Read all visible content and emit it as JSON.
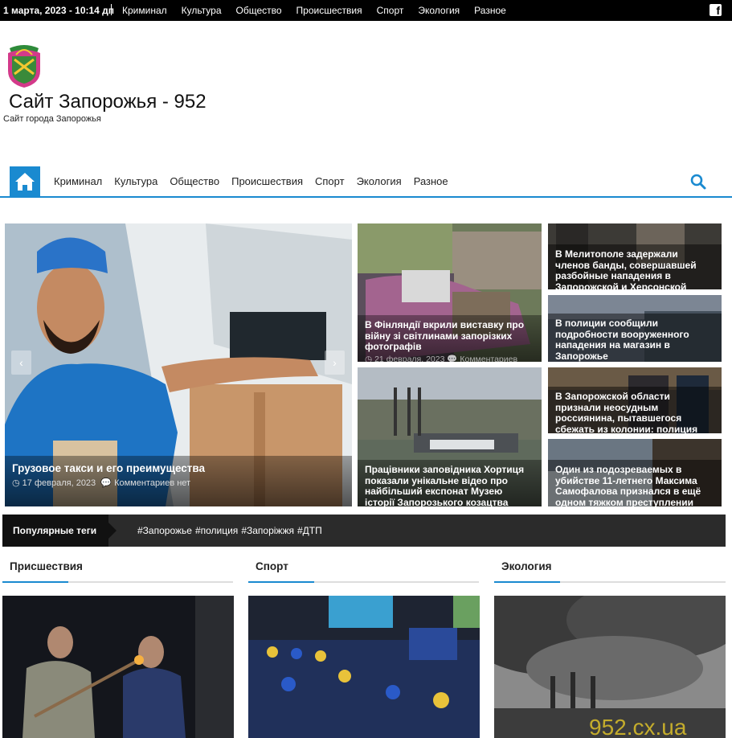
{
  "topbar": {
    "date": "1 марта, 2023 - 10:14 дп",
    "nav": [
      "Криминал",
      "Культура",
      "Общество",
      "Происшествия",
      "Спорт",
      "Экология",
      "Разное"
    ]
  },
  "header": {
    "title": "Сайт Запорожья - 952",
    "description": "Сайт города Запорожья"
  },
  "mainnav": {
    "items": [
      "Криминал",
      "Культура",
      "Общество",
      "Происшествия",
      "Спорт",
      "Экология",
      "Разное"
    ]
  },
  "hero": {
    "title": "Грузовое такси и его преимущества",
    "date": "17 февраля, 2023",
    "comments": "Комментариев нет"
  },
  "grid": [
    {
      "title": "В Фінляндії вкрили виставку про війну зі світлинами запорізких фотографів",
      "date": "21 февраля, 2023",
      "comments": "Комментариев"
    },
    {
      "title": "Працівники заповідника Хортиця показали унікальне відео про найбільший експонат Музею історії Запорозького козацтва",
      "date": "",
      "comments": ""
    },
    {
      "title": "В Мелитополе задержали членов банды, совершавшей разбойные нападения в Запорожской и Херсонской областях",
      "date": "",
      "comments": ""
    },
    {
      "title": "В полиции сообщили подробности вооруженного нападения на магазин в Запорожье",
      "date": "",
      "comments": ""
    },
    {
      "title": "В Запорожской области признали неосудным россиянина, пытавшегося сбежать из колонии: полиция доставила",
      "date": "",
      "comments": ""
    },
    {
      "title": "Один из подозреваемых в убийстве 11-летнего Максима Самофалова признался в ещё одном тяжком преступлении",
      "date": "",
      "comments": ""
    }
  ],
  "tags": {
    "label": "Популярные теги",
    "items": [
      "#Запорожье",
      "#полиция",
      "#Запоріжжя",
      "#ДТП"
    ]
  },
  "sections": [
    "Присшествия",
    "Спорт",
    "Экология"
  ],
  "watermark": "952.cx.ua",
  "colors": {
    "accent": "#1a8ad0",
    "topbar": "#000000",
    "tagsbar": "#2b2b2b"
  }
}
